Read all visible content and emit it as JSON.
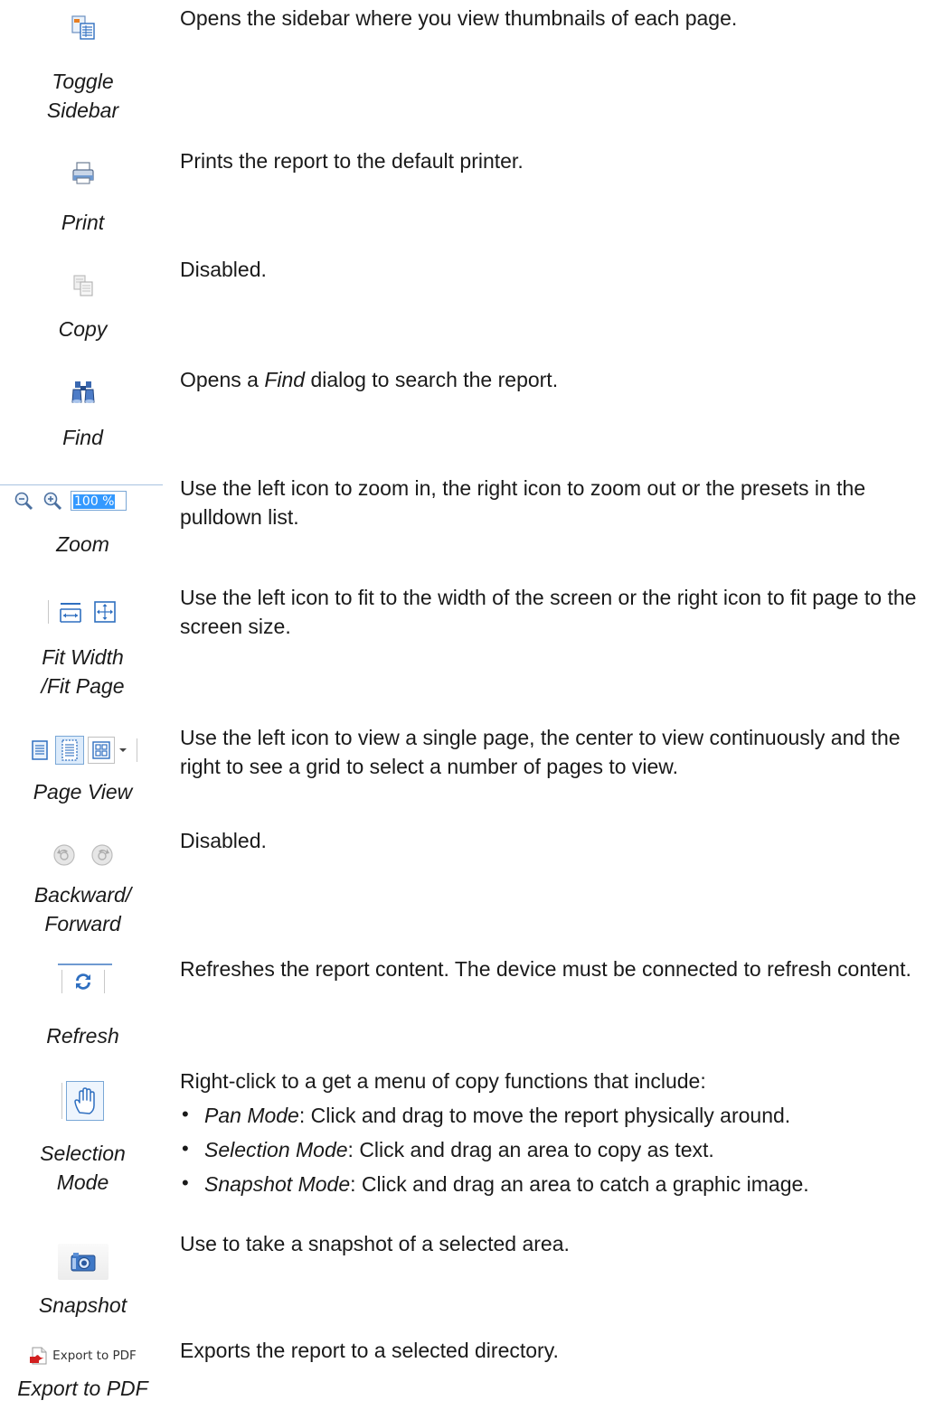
{
  "items": [
    {
      "caption_lines": [
        "Toggle",
        "Sidebar"
      ],
      "icon": "toggle-sidebar-icon",
      "description": "Opens the sidebar where you view thumbnails of each page."
    },
    {
      "caption_lines": [
        "Print"
      ],
      "icon": "printer-icon",
      "description": "Prints the report to the default printer."
    },
    {
      "caption_lines": [
        "Copy"
      ],
      "icon": "copy-icon",
      "description": "Disabled."
    },
    {
      "caption_lines": [
        "Find"
      ],
      "icon": "binoculars-icon",
      "description_before": "Opens a ",
      "description_em": "Find",
      "description_after": " dialog to search the report."
    },
    {
      "caption_lines": [
        "Zoom"
      ],
      "icons": [
        "zoom-in-icon",
        "zoom-out-icon"
      ],
      "zoom_value": "100 %",
      "description": "Use the left icon to zoom in, the right icon to zoom out or the presets in the pulldown list."
    },
    {
      "caption_lines": [
        "Fit Width",
        "/Fit Page"
      ],
      "icons": [
        "fit-width-icon",
        "fit-page-icon"
      ],
      "description": "Use the left icon to fit to the width of the screen or the right icon to fit page to the screen size."
    },
    {
      "caption_lines": [
        "Page View"
      ],
      "icons": [
        "single-page-icon",
        "continuous-page-icon",
        "grid-pages-icon",
        "dropdown-arrow-icon"
      ],
      "description": "Use the left icon to view a single page, the center to view continuously and the right to see a grid to select a number of pages to view."
    },
    {
      "caption_lines": [
        "Backward/",
        "Forward"
      ],
      "icons": [
        "backward-icon",
        "forward-icon"
      ],
      "description": "Disabled."
    },
    {
      "caption_lines": [
        "Refresh"
      ],
      "icon": "refresh-icon",
      "description": "Refreshes the report content. The device must be connected to refresh content."
    },
    {
      "caption_lines": [
        "Selection",
        "Mode"
      ],
      "icon": "hand-icon",
      "description": "Right-click to a get a menu of copy functions that include:",
      "bullets": [
        {
          "term": "Pan Mode",
          "text": ": Click and drag to move the report physically around."
        },
        {
          "term": "Selection Mode",
          "text": ": Click and drag an area to copy as text."
        },
        {
          "term": "Snapshot Mode",
          "text": ": Click and drag an area to catch a graphic image."
        }
      ]
    },
    {
      "caption_lines": [
        "Snapshot"
      ],
      "icon": "camera-icon",
      "description": "Use to take a snapshot of a selected area."
    },
    {
      "caption_lines": [
        "Export to PDF"
      ],
      "icon": "pdf-icon",
      "button_label": "Export to PDF",
      "description": "Exports the report to a selected directory."
    }
  ],
  "colors": {
    "text": "#1a1a1a",
    "icon_blue": "#2f6fc0",
    "selection_blue": "#3399ff",
    "disabled_gray": "#b8b8b8"
  }
}
